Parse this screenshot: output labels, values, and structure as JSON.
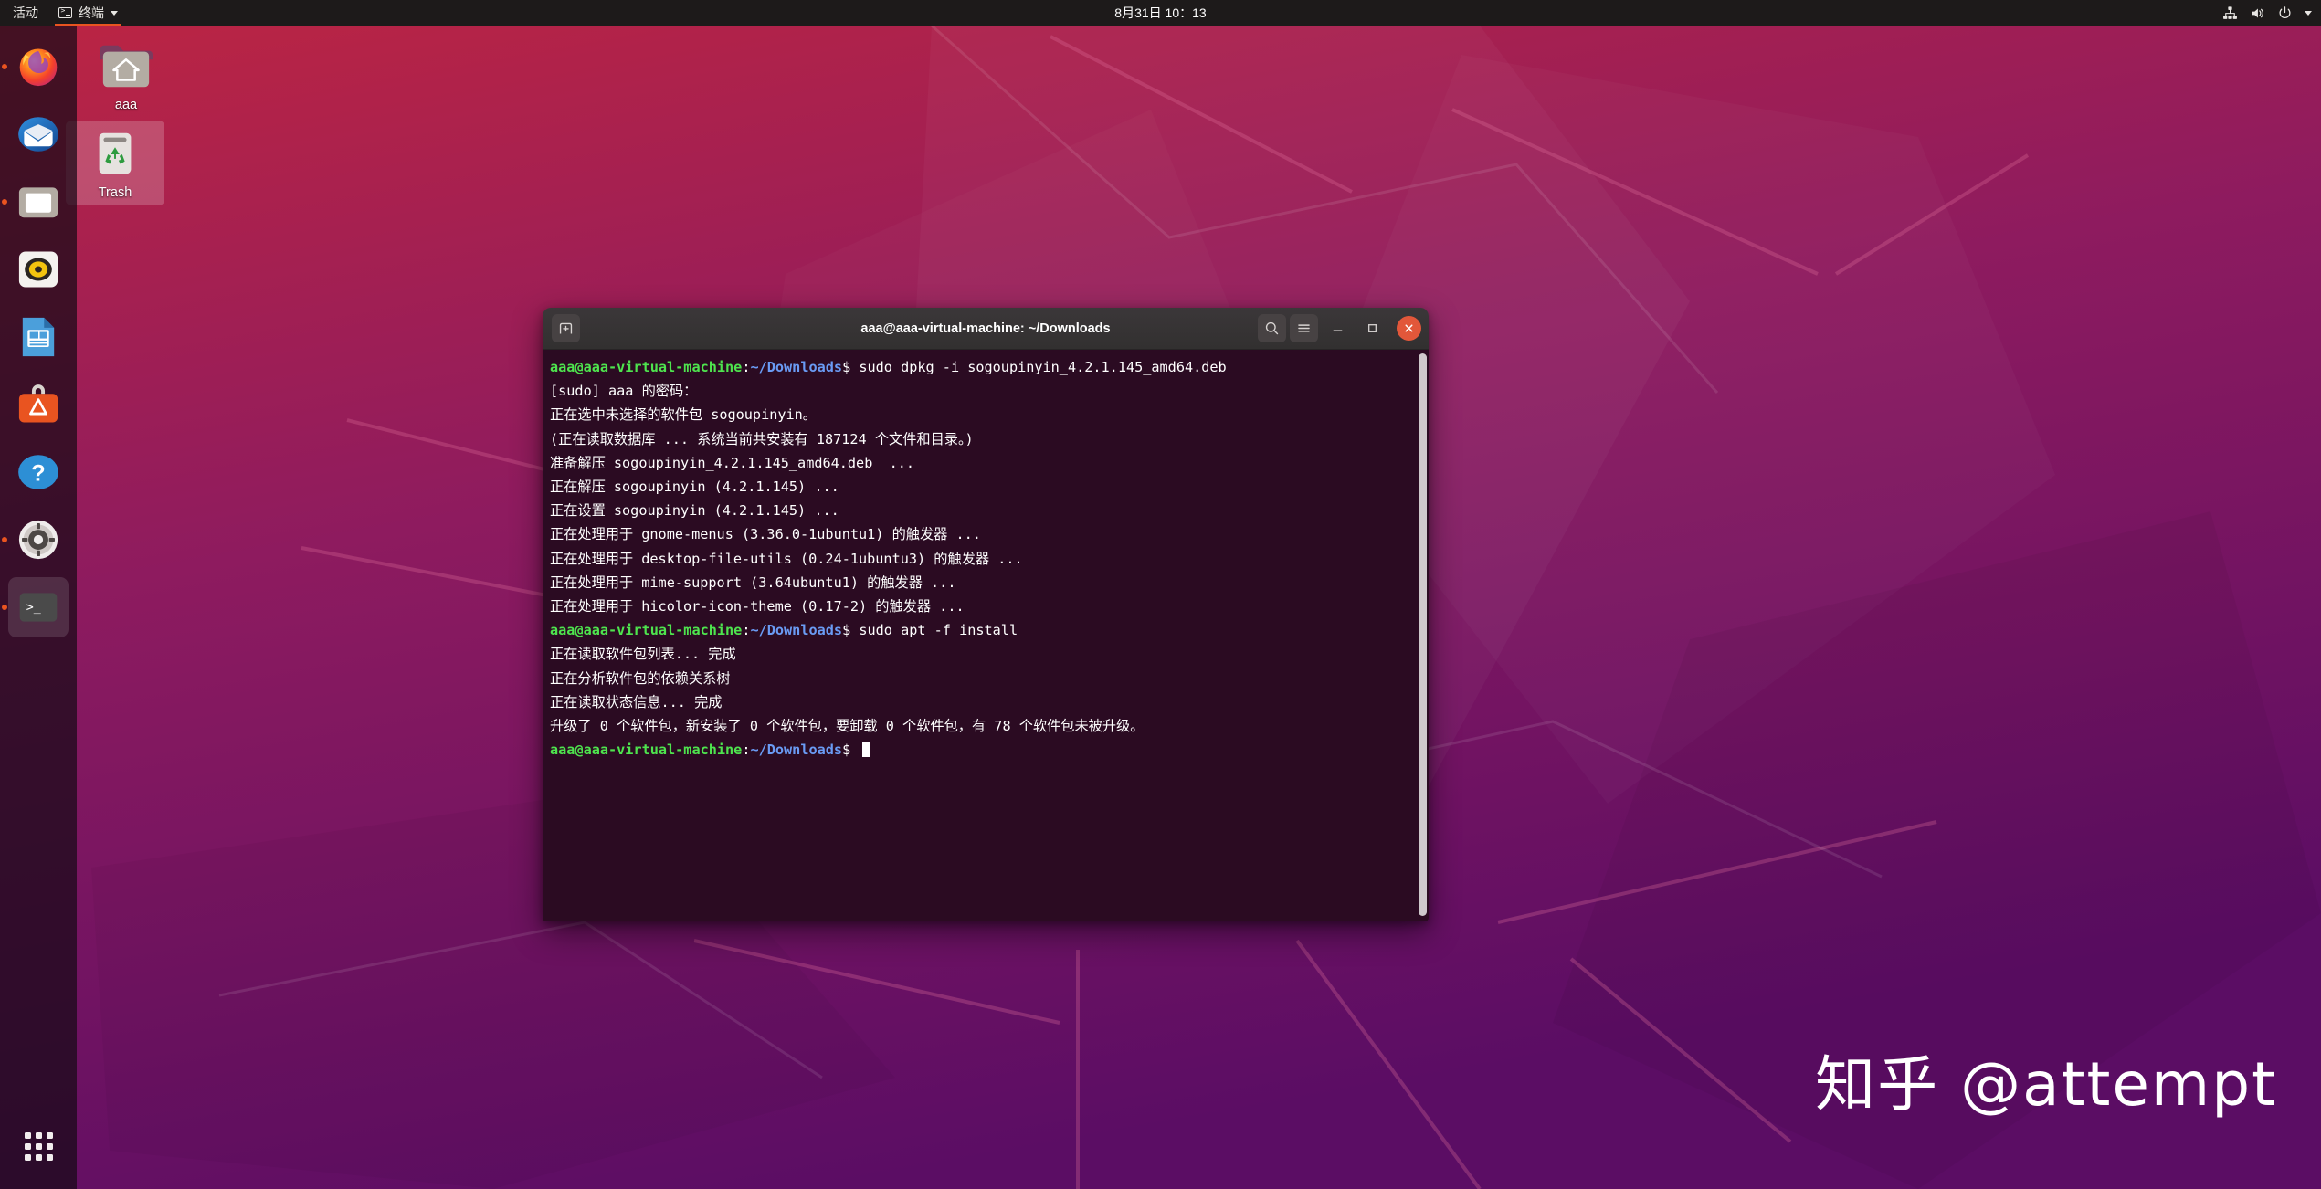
{
  "panel": {
    "activities": "活动",
    "app_name": "终端",
    "clock": "8月31日  10：13",
    "tray": [
      {
        "name": "network-icon"
      },
      {
        "name": "volume-icon"
      },
      {
        "name": "power-icon"
      },
      {
        "name": "chevron-down-icon"
      }
    ]
  },
  "dock": {
    "items": [
      {
        "name": "firefox",
        "label": "Firefox",
        "running": true,
        "active": false
      },
      {
        "name": "thunderbird",
        "label": "Thunderbird Mail",
        "running": false,
        "active": false
      },
      {
        "name": "files",
        "label": "Files",
        "running": true,
        "active": false
      },
      {
        "name": "rhythmbox",
        "label": "Rhythmbox",
        "running": false,
        "active": false
      },
      {
        "name": "libreoffice-writer",
        "label": "LibreOffice Writer",
        "running": false,
        "active": false
      },
      {
        "name": "ubuntu-software",
        "label": "Ubuntu Software",
        "running": false,
        "active": false
      },
      {
        "name": "help",
        "label": "Help",
        "running": false,
        "active": false
      },
      {
        "name": "settings",
        "label": "Settings",
        "running": true,
        "active": false
      },
      {
        "name": "terminal",
        "label": "Terminal",
        "running": true,
        "active": true
      }
    ],
    "show_apps_label": "Show Applications"
  },
  "desktop_icons": [
    {
      "name": "home-folder",
      "label": "aaa",
      "selected": false
    },
    {
      "name": "trash",
      "label": "Trash",
      "selected": true
    }
  ],
  "terminal": {
    "title": "aaa@aaa-virtual-machine: ~/Downloads",
    "new_tab_label": "+",
    "buttons": {
      "search": "search-icon",
      "menu": "hamburger-menu-icon",
      "minimize": "minimize-icon",
      "maximize": "maximize-icon",
      "close": "close-icon"
    },
    "prompt": {
      "user_host": "aaa@aaa-virtual-machine",
      "colon": ":",
      "path": "~/Downloads",
      "dollar": "$"
    },
    "lines": [
      {
        "type": "prompt",
        "command": " sudo dpkg -i sogoupinyin_4.2.1.145_amd64.deb"
      },
      {
        "type": "out",
        "text": "[sudo] aaa 的密码："
      },
      {
        "type": "out",
        "text": "正在选中未选择的软件包 sogoupinyin。"
      },
      {
        "type": "out",
        "text": "(正在读取数据库 ... 系统当前共安装有 187124 个文件和目录。)"
      },
      {
        "type": "out",
        "text": "准备解压 sogoupinyin_4.2.1.145_amd64.deb  ..."
      },
      {
        "type": "out",
        "text": "正在解压 sogoupinyin (4.2.1.145) ..."
      },
      {
        "type": "out",
        "text": "正在设置 sogoupinyin (4.2.1.145) ..."
      },
      {
        "type": "out",
        "text": "正在处理用于 gnome-menus (3.36.0-1ubuntu1) 的触发器 ..."
      },
      {
        "type": "out",
        "text": "正在处理用于 desktop-file-utils (0.24-1ubuntu3) 的触发器 ..."
      },
      {
        "type": "out",
        "text": "正在处理用于 mime-support (3.64ubuntu1) 的触发器 ..."
      },
      {
        "type": "out",
        "text": "正在处理用于 hicolor-icon-theme (0.17-2) 的触发器 ..."
      },
      {
        "type": "prompt",
        "command": " sudo apt -f install"
      },
      {
        "type": "out",
        "text": "正在读取软件包列表... 完成"
      },
      {
        "type": "out",
        "text": "正在分析软件包的依赖关系树"
      },
      {
        "type": "out",
        "text": "正在读取状态信息... 完成"
      },
      {
        "type": "out",
        "text": "升级了 0 个软件包，新安装了 0 个软件包，要卸载 0 个软件包，有 78 个软件包未被升级。"
      },
      {
        "type": "prompt_cursor",
        "command": " "
      }
    ]
  },
  "watermark": {
    "text": "知乎 @attempt"
  },
  "colors": {
    "accent": "#e95420",
    "terminal_bg": "#2b0b22",
    "titlebar_bg": "#323030",
    "panel_bg": "#1d1a1a",
    "prompt_user": "#4ee44e",
    "prompt_path": "#6a9bf4",
    "close_button": "#e2573a"
  }
}
